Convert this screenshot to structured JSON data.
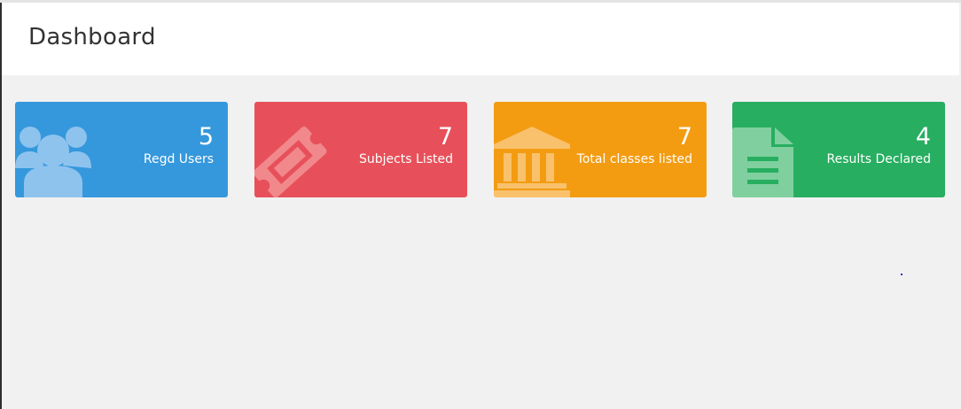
{
  "header": {
    "title": "Dashboard"
  },
  "cards": [
    {
      "value": "5",
      "label": "Regd Users",
      "color": "#3598dc",
      "icon": "users-icon"
    },
    {
      "value": "7",
      "label": "Subjects Listed",
      "color": "#e7505a",
      "icon": "ticket-icon"
    },
    {
      "value": "7",
      "label": "Total classes listed",
      "color": "#f39c12",
      "icon": "bank-icon"
    },
    {
      "value": "4",
      "label": "Results Declared",
      "color": "#27ae60",
      "icon": "file-text-icon"
    }
  ]
}
